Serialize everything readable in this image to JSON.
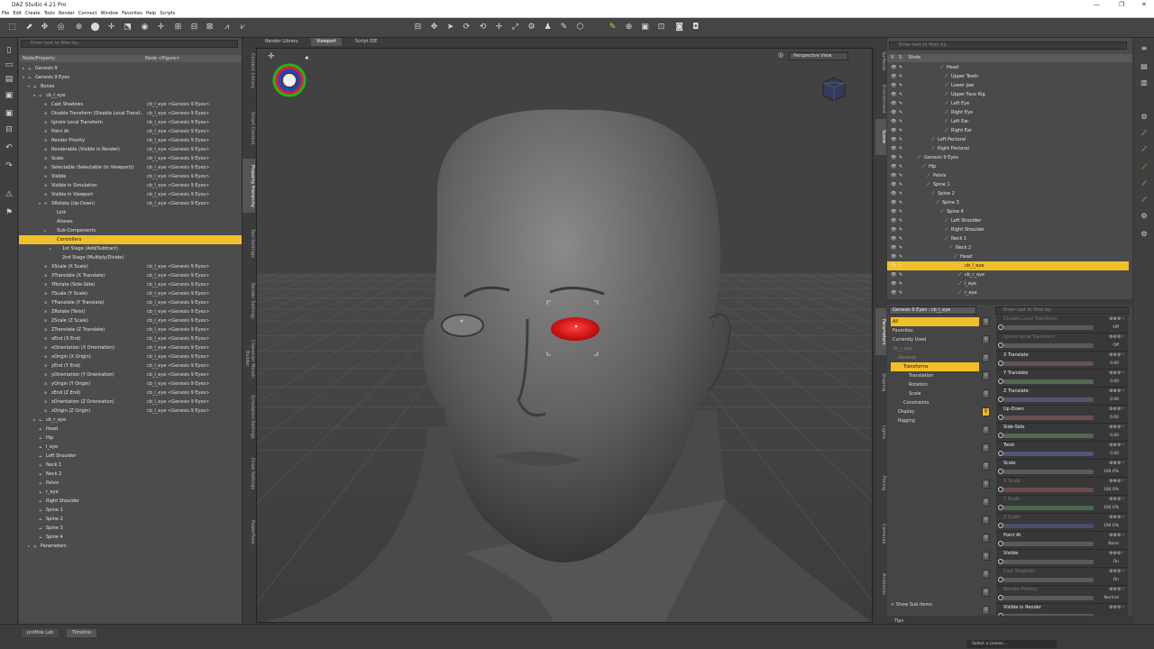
{
  "window": {
    "title": "DAZ Studio 4.21 Pro"
  },
  "menu": [
    "File",
    "Edit",
    "Create",
    "Tools",
    "Render",
    "Connect",
    "Window",
    "Favorites",
    "Help",
    "Scripts"
  ],
  "left_panel": {
    "filter_placeholder": "Enter text to filter by...",
    "col_node": "Node/Property",
    "col_value": "Node <Figure>",
    "rows": [
      {
        "l": "Genesis 9",
        "ind": 0,
        "ex": "▸"
      },
      {
        "l": "Genesis 9 Eyes",
        "ind": 0,
        "ex": "▾"
      },
      {
        "l": "Bones",
        "ind": 1,
        "ex": "▾"
      },
      {
        "l": "cb_l_eye",
        "ind": 2,
        "ex": "▾"
      },
      {
        "l": "Cast Shadows",
        "ind": 3,
        "v": "cb_l_eye <Genesis 9 Eyes>"
      },
      {
        "l": "Disable Transform (Disable Local Transf...",
        "ind": 3,
        "v": "cb_l_eye <Genesis 9 Eyes>"
      },
      {
        "l": "Ignore Local Transform",
        "ind": 3,
        "v": "cb_l_eye <Genesis 9 Eyes>"
      },
      {
        "l": "Point At",
        "ind": 3,
        "v": "cb_l_eye <Genesis 9 Eyes>"
      },
      {
        "l": "Render Priority",
        "ind": 3,
        "v": "cb_l_eye <Genesis 9 Eyes>"
      },
      {
        "l": "Renderable (Visible in Render)",
        "ind": 3,
        "v": "cb_l_eye <Genesis 9 Eyes>"
      },
      {
        "l": "Scale",
        "ind": 3,
        "v": "cb_l_eye <Genesis 9 Eyes>"
      },
      {
        "l": "Selectable (Selectable (In Viewport))",
        "ind": 3,
        "v": "cb_l_eye <Genesis 9 Eyes>"
      },
      {
        "l": "Visible",
        "ind": 3,
        "v": "cb_l_eye <Genesis 9 Eyes>"
      },
      {
        "l": "Visible in Simulation",
        "ind": 3,
        "v": "cb_l_eye <Genesis 9 Eyes>"
      },
      {
        "l": "Visible in Viewport",
        "ind": 3,
        "v": "cb_l_eye <Genesis 9 Eyes>"
      },
      {
        "l": "XRotate (Up-Down)",
        "ind": 3,
        "v": "cb_l_eye <Genesis 9 Eyes>",
        "ex": "▾"
      },
      {
        "l": "Link",
        "ind": 4
      },
      {
        "l": "Aliases",
        "ind": 4
      },
      {
        "l": "Sub-Components",
        "ind": 4,
        "ex": "▸"
      },
      {
        "l": "Controllers",
        "ind": 4,
        "ex": "▾",
        "sel": true
      },
      {
        "l": "1st Stage (Add/Subtract)",
        "ind": 5,
        "ex": "▸"
      },
      {
        "l": "2nd Stage (Multiply/Divide)",
        "ind": 5
      },
      {
        "l": "XScale (X Scale)",
        "ind": 3,
        "v": "cb_l_eye <Genesis 9 Eyes>"
      },
      {
        "l": "XTranslate (X Translate)",
        "ind": 3,
        "v": "cb_l_eye <Genesis 9 Eyes>"
      },
      {
        "l": "YRotate (Side-Side)",
        "ind": 3,
        "v": "cb_l_eye <Genesis 9 Eyes>"
      },
      {
        "l": "YScale (Y Scale)",
        "ind": 3,
        "v": "cb_l_eye <Genesis 9 Eyes>"
      },
      {
        "l": "YTranslate (Y Translate)",
        "ind": 3,
        "v": "cb_l_eye <Genesis 9 Eyes>"
      },
      {
        "l": "ZRotate (Twist)",
        "ind": 3,
        "v": "cb_l_eye <Genesis 9 Eyes>"
      },
      {
        "l": "ZScale (Z Scale)",
        "ind": 3,
        "v": "cb_l_eye <Genesis 9 Eyes>"
      },
      {
        "l": "ZTranslate (Z Translate)",
        "ind": 3,
        "v": "cb_l_eye <Genesis 9 Eyes>"
      },
      {
        "l": "xEnd (X End)",
        "ind": 3,
        "v": "cb_l_eye <Genesis 9 Eyes>"
      },
      {
        "l": "xOrientation (X Orientation)",
        "ind": 3,
        "v": "cb_l_eye <Genesis 9 Eyes>"
      },
      {
        "l": "xOrigin (X Origin)",
        "ind": 3,
        "v": "cb_l_eye <Genesis 9 Eyes>"
      },
      {
        "l": "yEnd (Y End)",
        "ind": 3,
        "v": "cb_l_eye <Genesis 9 Eyes>"
      },
      {
        "l": "yOrientation (Y Orientation)",
        "ind": 3,
        "v": "cb_l_eye <Genesis 9 Eyes>"
      },
      {
        "l": "yOrigin (Y Origin)",
        "ind": 3,
        "v": "cb_l_eye <Genesis 9 Eyes>"
      },
      {
        "l": "zEnd (Z End)",
        "ind": 3,
        "v": "cb_l_eye <Genesis 9 Eyes>"
      },
      {
        "l": "zOrientation (Z Orientation)",
        "ind": 3,
        "v": "cb_l_eye <Genesis 9 Eyes>"
      },
      {
        "l": "zOrigin (Z Origin)",
        "ind": 3,
        "v": "cb_l_eye <Genesis 9 Eyes>"
      },
      {
        "l": "cb_r_eye",
        "ind": 2,
        "ex": "▸"
      },
      {
        "l": "Head",
        "ind": 2
      },
      {
        "l": "Hip",
        "ind": 2
      },
      {
        "l": "l_eye",
        "ind": 2
      },
      {
        "l": "Left Shoulder",
        "ind": 2
      },
      {
        "l": "Neck 1",
        "ind": 2
      },
      {
        "l": "Neck 2",
        "ind": 2
      },
      {
        "l": "Pelvis",
        "ind": 2
      },
      {
        "l": "r_eye",
        "ind": 2
      },
      {
        "l": "Right Shoulder",
        "ind": 2
      },
      {
        "l": "Spine 1",
        "ind": 2
      },
      {
        "l": "Spine 2",
        "ind": 2
      },
      {
        "l": "Spine 3",
        "ind": 2
      },
      {
        "l": "Spine 4",
        "ind": 2
      },
      {
        "l": "Parameters",
        "ind": 1,
        "ex": "▸"
      }
    ]
  },
  "left_vtabs": [
    "Content Library",
    "Smart Content",
    "Property Hierarchy",
    "Tool Settings",
    "Render Settings",
    "Character Morph Builder",
    "Simulation Settings",
    "Draw Settings",
    "PowerPose"
  ],
  "center_tabs": [
    "Render Library",
    "Viewport",
    "Script IDE"
  ],
  "viewport": {
    "camera": "Perspective View"
  },
  "right_vtabs": [
    "Surfaces",
    "Environment",
    "Scene",
    "Parameters",
    "Shaping",
    "Lights",
    "Posing",
    "Cameras",
    "Aniblocks"
  ],
  "scene": {
    "filter_placeholder": "Enter text to filter by...",
    "col": "Node",
    "rows": [
      {
        "l": "Head",
        "ind": 7
      },
      {
        "l": "Upper Teeth",
        "ind": 8
      },
      {
        "l": "Lower Jaw",
        "ind": 8
      },
      {
        "l": "Upper Face Rig",
        "ind": 8
      },
      {
        "l": "Left Eye",
        "ind": 8
      },
      {
        "l": "Right Eye",
        "ind": 8
      },
      {
        "l": "Left Ear",
        "ind": 8
      },
      {
        "l": "Right Ear",
        "ind": 8
      },
      {
        "l": "Left Pectoral",
        "ind": 5
      },
      {
        "l": "Right Pectoral",
        "ind": 5
      },
      {
        "l": "Genesis 9 Eyes",
        "ind": 2
      },
      {
        "l": "Hip",
        "ind": 3
      },
      {
        "l": "Pelvis",
        "ind": 4
      },
      {
        "l": "Spine 1",
        "ind": 4
      },
      {
        "l": "Spine 2",
        "ind": 5
      },
      {
        "l": "Spine 3",
        "ind": 6
      },
      {
        "l": "Spine 4",
        "ind": 7
      },
      {
        "l": "Left Shoulder",
        "ind": 8
      },
      {
        "l": "Right Shoulder",
        "ind": 8
      },
      {
        "l": "Neck 1",
        "ind": 8
      },
      {
        "l": "Neck 2",
        "ind": 9
      },
      {
        "l": "Head",
        "ind": 10
      },
      {
        "l": "cb_l_eye",
        "ind": 11,
        "sel": true
      },
      {
        "l": "cb_r_eye",
        "ind": 11
      },
      {
        "l": "l_eye",
        "ind": 11
      },
      {
        "l": "r_eye",
        "ind": 11
      }
    ]
  },
  "params": {
    "selector": "Genesis 9 Eyes : cb_l_eye",
    "filter_placeholder": "Enter text to filter by...",
    "categories": [
      {
        "l": "All",
        "ind": 0,
        "sel": true
      },
      {
        "l": "Favorites",
        "ind": 0
      },
      {
        "l": "Currently Used",
        "ind": 0
      },
      {
        "l": "cb_l_eye",
        "ind": 0,
        "dim": true
      },
      {
        "l": "General",
        "ind": 1,
        "dim": true
      },
      {
        "l": "Transforms",
        "ind": 2,
        "sel": true
      },
      {
        "l": "Translation",
        "ind": 3
      },
      {
        "l": "Rotation",
        "ind": 3
      },
      {
        "l": "Scale",
        "ind": 3
      },
      {
        "l": "Constraints",
        "ind": 2
      },
      {
        "l": "Display",
        "ind": 1
      },
      {
        "l": "Rigging",
        "ind": 1
      }
    ],
    "show_sub": "Show Sub Items",
    "items": [
      {
        "l": "Disable Local Transform",
        "v": "Off",
        "c": "#5a5a5a",
        "dim": true
      },
      {
        "l": "Ignore Local Transform",
        "v": "Off",
        "c": "#5a5a5a",
        "dim": true
      },
      {
        "l": "X Translate",
        "v": "0.00",
        "c": "#6a5050"
      },
      {
        "l": "Y Translate",
        "v": "0.00",
        "c": "#506a50"
      },
      {
        "l": "Z Translate",
        "v": "0.00",
        "c": "#50567a"
      },
      {
        "l": "Up-Down",
        "v": "0.00",
        "c": "#6a5050",
        "hl": true
      },
      {
        "l": "Side-Side",
        "v": "0.00",
        "c": "#506a50"
      },
      {
        "l": "Twist",
        "v": "0.00",
        "c": "#50567a"
      },
      {
        "l": "Scale",
        "v": "100.0%",
        "c": "#5a5a5a"
      },
      {
        "l": "X Scale",
        "v": "100.0%",
        "c": "#6a4a4a",
        "dim": true
      },
      {
        "l": "Y Scale",
        "v": "100.0%",
        "c": "#4a6a4a",
        "dim": true
      },
      {
        "l": "Z Scale",
        "v": "100.0%",
        "c": "#4a4e6a",
        "dim": true
      },
      {
        "l": "Point At",
        "v": "None",
        "c": "#5a5a5a"
      },
      {
        "l": "Visible",
        "v": "On",
        "c": "#5a5a5a"
      },
      {
        "l": "Cast Shadows",
        "v": "On",
        "c": "#5a5a5a",
        "dim": true
      },
      {
        "l": "Render Priority",
        "v": "Normal",
        "c": "#5a5a5a",
        "dim": true
      },
      {
        "l": "Visible in Render",
        "v": "",
        "c": "#5a5a5a"
      }
    ]
  },
  "bottom": {
    "tabs": [
      "proMde Lab",
      "Timeline"
    ],
    "lesson": "Select a Lesson...",
    "tips": "Tips"
  }
}
